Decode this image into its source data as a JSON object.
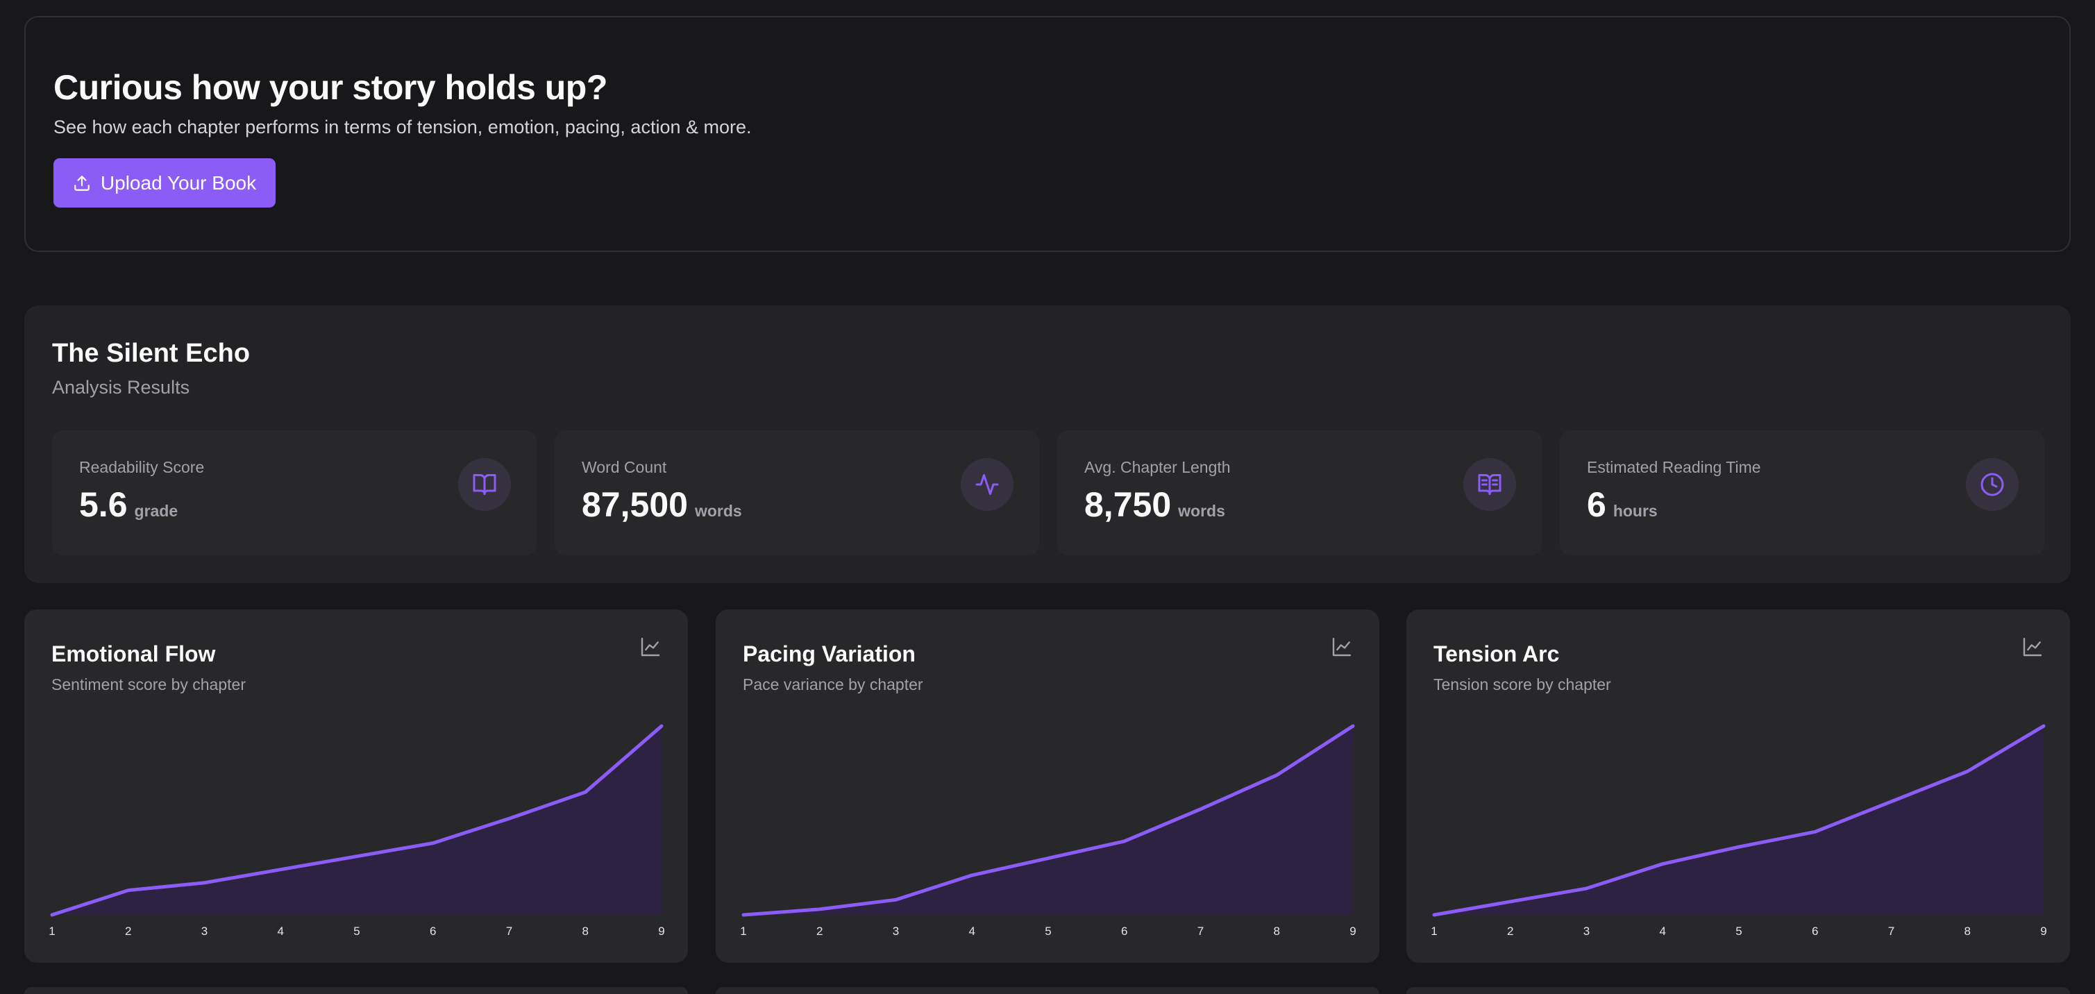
{
  "hero": {
    "title": "Curious how your story holds up?",
    "description": "See how each chapter performs in terms of tension, emotion, pacing, action & more.",
    "upload_label": "Upload Your Book",
    "upload_icon": "upload-icon"
  },
  "book": {
    "title": "The Silent Echo",
    "subtitle": "Analysis Results"
  },
  "stats": [
    {
      "label": "Readability Score",
      "value": "5.6",
      "unit": "grade",
      "icon": "book-open-icon"
    },
    {
      "label": "Word Count",
      "value": "87,500",
      "unit": "words",
      "icon": "activity-icon"
    },
    {
      "label": "Avg. Chapter Length",
      "value": "8,750",
      "unit": "words",
      "icon": "book-text-icon"
    },
    {
      "label": "Estimated Reading Time",
      "value": "6",
      "unit": "hours",
      "icon": "clock-icon"
    }
  ],
  "colors": {
    "accent": "#8b5cf6",
    "line": "#8b5cf6",
    "area": "#2e2242",
    "background": "#18181b",
    "card": "#28282b"
  },
  "chart_data": [
    {
      "type": "area",
      "title": "Emotional Flow",
      "subtitle": "Sentiment score by chapter",
      "x": [
        1,
        2,
        3,
        4,
        5,
        6,
        7,
        8,
        9
      ],
      "values": [
        0,
        13,
        17,
        24,
        31,
        38,
        51,
        65,
        100
      ],
      "ylim": [
        0,
        100
      ],
      "grid": false
    },
    {
      "type": "area",
      "title": "Pacing Variation",
      "subtitle": "Pace variance by chapter",
      "x": [
        1,
        2,
        3,
        4,
        5,
        6,
        7,
        8,
        9
      ],
      "values": [
        0,
        3,
        8,
        21,
        30,
        39,
        56,
        74,
        100
      ],
      "ylim": [
        0,
        100
      ],
      "grid": false
    },
    {
      "type": "area",
      "title": "Tension Arc",
      "subtitle": "Tension score by chapter",
      "x": [
        1,
        2,
        3,
        4,
        5,
        6,
        7,
        8,
        9
      ],
      "values": [
        0,
        7,
        14,
        27,
        36,
        44,
        60,
        76,
        100
      ],
      "ylim": [
        0,
        100
      ],
      "grid": false
    }
  ]
}
